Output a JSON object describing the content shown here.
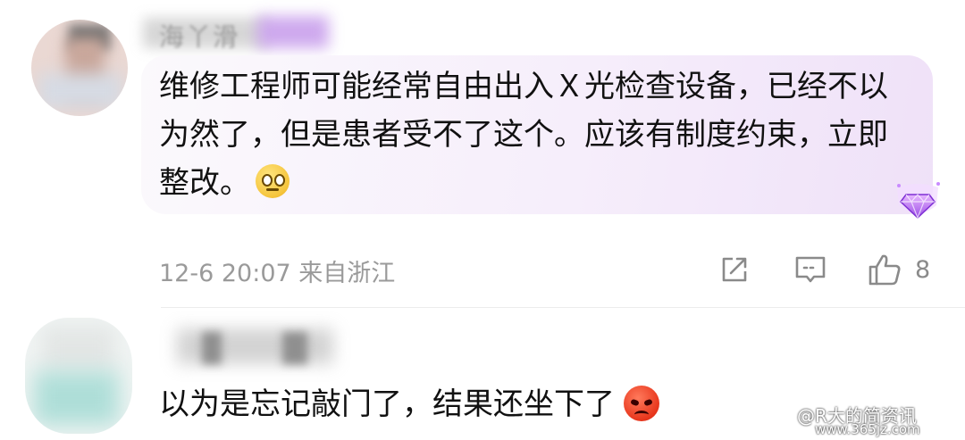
{
  "comments": [
    {
      "username": "海丫滑",
      "text": "维修工程师可能经常自由出入Ｘ光检查设备，已经不以为然了，但是患者受不了这个。应该有制度约束，立即整改。",
      "emoji": "smile-emoji",
      "date": "12-6 20:07",
      "location": "来自浙江",
      "like_count": "8"
    },
    {
      "text": "以为是忘记敲门了，结果还坐下了",
      "emoji": "angry-emoji"
    }
  ],
  "watermark": {
    "line1": "@R大的简资讯",
    "line2": "www.365jz.com"
  },
  "icons": [
    "share-icon",
    "reply-icon",
    "thumbs-up-icon",
    "vip-gem-badge-icon"
  ],
  "colors": {
    "bubble_accent": "#efe1f8",
    "username_badge": "#c9a0ec",
    "meta_text": "#9a9a9a"
  }
}
